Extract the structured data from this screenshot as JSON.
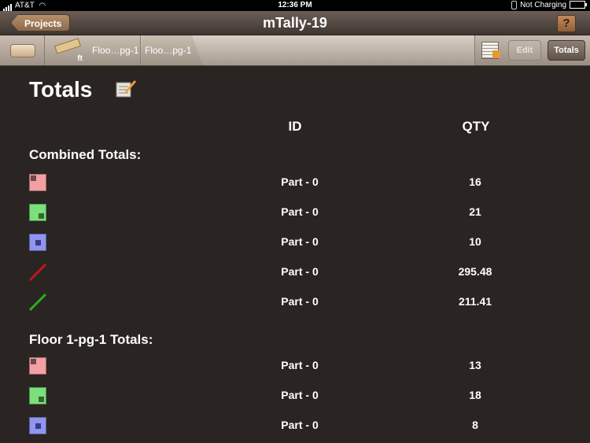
{
  "status_bar": {
    "carrier": "AT&T",
    "time": "12:36 PM",
    "battery": "Not Charging"
  },
  "nav": {
    "back_label": "Projects",
    "title": "mTally-19",
    "help_label": "?"
  },
  "toolbar": {
    "ruler_unit": "ft",
    "page_tabs": [
      "Floo…pg-1",
      "Floo…pg-1"
    ],
    "edit_label": "Edit",
    "totals_label": "Totals"
  },
  "page": {
    "title": "Totals"
  },
  "table": {
    "header_id": "ID",
    "header_qty": "QTY"
  },
  "sections": [
    {
      "title": "Combined Totals:",
      "rows": [
        {
          "icon": "red-square-icon",
          "id": "Part - 0",
          "qty": "16"
        },
        {
          "icon": "green-square-icon",
          "id": "Part - 0",
          "qty": "21"
        },
        {
          "icon": "blue-square-icon",
          "id": "Part - 0",
          "qty": "10"
        },
        {
          "icon": "red-line-icon",
          "id": "Part - 0",
          "qty": "295.48"
        },
        {
          "icon": "green-line-icon",
          "id": "Part - 0",
          "qty": "211.41"
        }
      ]
    },
    {
      "title": "Floor 1-pg-1 Totals:",
      "rows": [
        {
          "icon": "red-square-icon",
          "id": "Part - 0",
          "qty": "13"
        },
        {
          "icon": "green-square-icon",
          "id": "Part - 0",
          "qty": "18"
        },
        {
          "icon": "blue-square-icon",
          "id": "Part - 0",
          "qty": "8"
        }
      ]
    }
  ],
  "colors": {
    "red": "#f3a0a4",
    "green": "#7be07a",
    "blue": "#8f95f0",
    "line_red": "#c0171a",
    "line_green": "#22b022"
  }
}
